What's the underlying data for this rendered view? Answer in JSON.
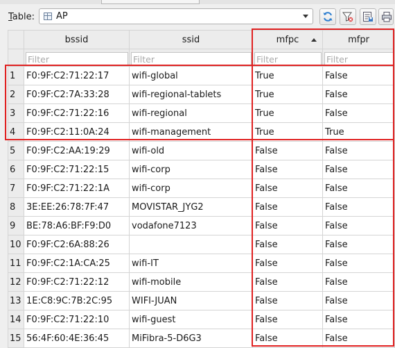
{
  "toolbar": {
    "table_label_mnemonic": "T",
    "table_label_rest": "able:",
    "table_value": "AP",
    "buttons": [
      {
        "icon": "refresh-icon"
      },
      {
        "icon": "clear-filters-icon"
      },
      {
        "icon": "save-table-icon"
      },
      {
        "icon": "print-icon"
      }
    ]
  },
  "grid": {
    "columns": [
      "bssid",
      "ssid",
      "mfpc",
      "mfpr"
    ],
    "sorted_column": "mfpc",
    "sort_direction": "ascending",
    "filter_placeholder": "Filter",
    "rows": [
      {
        "n": "1",
        "bssid": "F0:9F:C2:71:22:17",
        "ssid": "wifi-global",
        "mfpc": "True",
        "mfpr": "False"
      },
      {
        "n": "2",
        "bssid": "F0:9F:C2:7A:33:28",
        "ssid": "wifi-regional-tablets",
        "mfpc": "True",
        "mfpr": "False"
      },
      {
        "n": "3",
        "bssid": "F0:9F:C2:71:22:16",
        "ssid": "wifi-regional",
        "mfpc": "True",
        "mfpr": "False"
      },
      {
        "n": "4",
        "bssid": "F0:9F:C2:11:0A:24",
        "ssid": "wifi-management",
        "mfpc": "True",
        "mfpr": "True"
      },
      {
        "n": "5",
        "bssid": "F0:9F:C2:AA:19:29",
        "ssid": "wifi-old",
        "mfpc": "False",
        "mfpr": "False"
      },
      {
        "n": "6",
        "bssid": "F0:9F:C2:71:22:15",
        "ssid": "wifi-corp",
        "mfpc": "False",
        "mfpr": "False"
      },
      {
        "n": "7",
        "bssid": "F0:9F:C2:71:22:1A",
        "ssid": "wifi-corp",
        "mfpc": "False",
        "mfpr": "False"
      },
      {
        "n": "8",
        "bssid": "3E:EE:26:78:7F:47",
        "ssid": "MOVISTAR_JYG2",
        "mfpc": "False",
        "mfpr": "False"
      },
      {
        "n": "9",
        "bssid": "BE:78:A6:BF:F9:D0",
        "ssid": "vodafone7123",
        "mfpc": "False",
        "mfpr": "False"
      },
      {
        "n": "10",
        "bssid": "F0:9F:C2:6A:88:26",
        "ssid": "",
        "mfpc": "False",
        "mfpr": "False"
      },
      {
        "n": "11",
        "bssid": "F0:9F:C2:1A:CA:25",
        "ssid": "wifi-IT",
        "mfpc": "False",
        "mfpr": "False"
      },
      {
        "n": "12",
        "bssid": "F0:9F:C2:71:22:12",
        "ssid": "wifi-mobile",
        "mfpc": "False",
        "mfpr": "False"
      },
      {
        "n": "13",
        "bssid": "1E:C8:9C:7B:2C:95",
        "ssid": "WIFI-JUAN",
        "mfpc": "False",
        "mfpr": "False"
      },
      {
        "n": "14",
        "bssid": "F0:9F:C2:71:22:10",
        "ssid": "wifi-guest",
        "mfpc": "False",
        "mfpr": "False"
      },
      {
        "n": "15",
        "bssid": "56:4F:60:4E:36:45",
        "ssid": "MiFibra-5-D6G3",
        "mfpc": "False",
        "mfpr": "False"
      }
    ]
  },
  "annotations": {
    "color": "#e02020",
    "boxes": [
      "rows-1-4",
      "mfpc-mfpr-columns"
    ]
  }
}
